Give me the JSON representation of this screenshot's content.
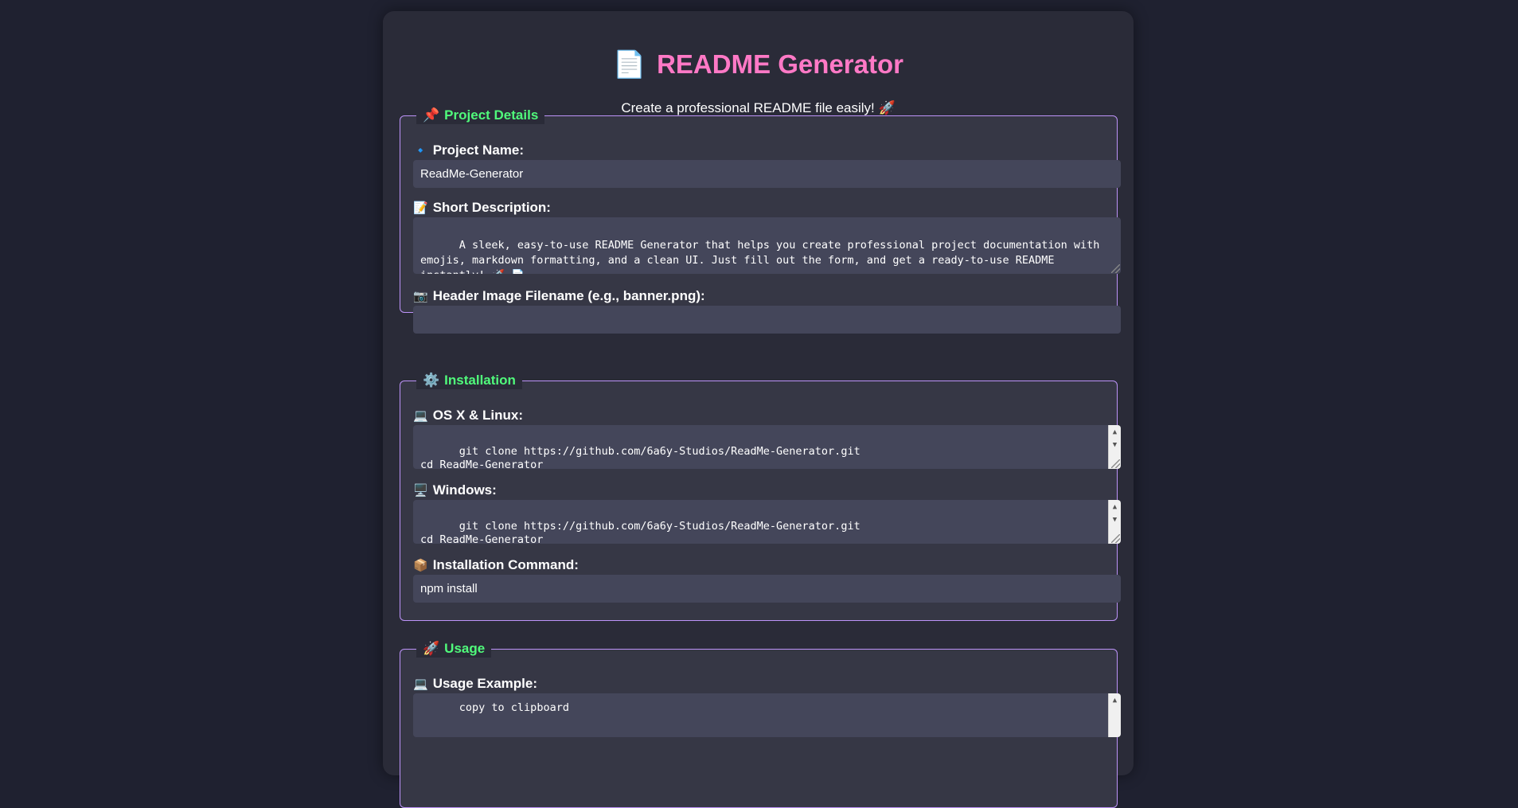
{
  "header": {
    "title_emoji": "📄",
    "title": "README Generator",
    "subtitle": "Create a professional README file easily! 🚀"
  },
  "project_details": {
    "legend_emoji": "📌",
    "legend": "Project Details",
    "name_label_emoji": "🔹",
    "name_label": "Project Name:",
    "name_value": "ReadMe-Generator",
    "desc_label_emoji": "📝",
    "desc_label": "Short Description:",
    "desc_value": "A sleek, easy-to-use README Generator that helps you create professional project documentation with emojis, markdown formatting, and a clean UI. Just fill out the form, and get a ready-to-use README instantly! 🚀 📄",
    "header_image_label_emoji": "📷",
    "header_image_label": "Header Image Filename (e.g., banner.png):",
    "header_image_value": ""
  },
  "installation": {
    "legend_emoji": "⚙️",
    "legend": "Installation",
    "osx_label_emoji": "💻",
    "osx_label": "OS X & Linux:",
    "osx_value": "git clone https://github.com/6a6y-Studios/ReadMe-Generator.git\ncd ReadMe-Generator\nnpm install",
    "windows_label_emoji": "🖥️",
    "windows_label": "Windows:",
    "windows_value": "git clone https://github.com/6a6y-Studios/ReadMe-Generator.git\ncd ReadMe-Generator\nnpm install",
    "command_label_emoji": "📦",
    "command_label": "Installation Command:",
    "command_value": "npm install"
  },
  "usage": {
    "legend_emoji": "🚀",
    "legend": "Usage",
    "example_label_emoji": "💻",
    "example_label": "Usage Example:",
    "example_value": "copy to clipboard"
  },
  "colors": {
    "page_bg": "#1f2130",
    "card_bg": "#2a2b38",
    "title": "#ff79c6",
    "legend": "#50fa7b",
    "fieldset_border": "#bd93f9",
    "input_bg": "#44465a"
  }
}
